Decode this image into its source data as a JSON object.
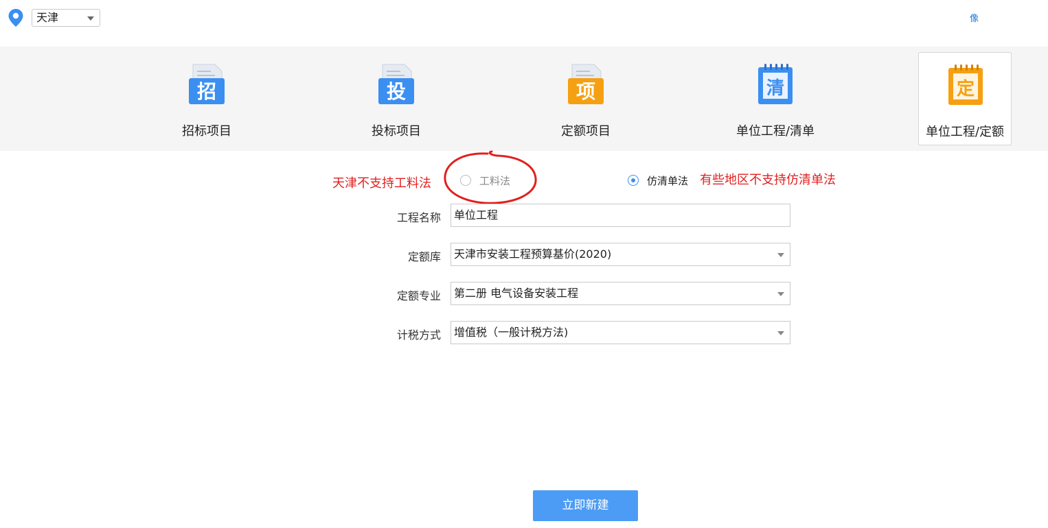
{
  "topbar": {
    "region": "天津",
    "right_link": "像"
  },
  "tools": [
    {
      "glyph": "招",
      "label": "招标项目",
      "color": "#3b8ff0",
      "selected": false
    },
    {
      "glyph": "投",
      "label": "投标项目",
      "color": "#3b8ff0",
      "selected": false
    },
    {
      "glyph": "项",
      "label": "定额项目",
      "color": "#f5a012",
      "selected": false
    },
    {
      "glyph": "清",
      "label": "单位工程/清单",
      "color": "#3b8ff0",
      "selected": false
    },
    {
      "glyph": "定",
      "label": "单位工程/定额",
      "color": "#f5a012",
      "selected": true
    }
  ],
  "method": {
    "note_left": "天津不支持工料法",
    "option1": "工料法",
    "option2": "仿清单法",
    "note_right": "有些地区不支持仿清单法"
  },
  "form": {
    "project_name_label": "工程名称",
    "project_name_value": "单位工程",
    "quota_lib_label": "定额库",
    "quota_lib_value": "天津市安装工程预算基价(2020)",
    "quota_major_label": "定额专业",
    "quota_major_value": "第二册 电气设备安装工程",
    "tax_label": "计税方式",
    "tax_value": "增值税（一般计税方法)"
  },
  "create_button": "立即新建",
  "colors": {
    "accent": "#3b8ff0",
    "orange": "#f5a012",
    "annotation_red": "#e02020",
    "button": "#4c9cf5"
  }
}
